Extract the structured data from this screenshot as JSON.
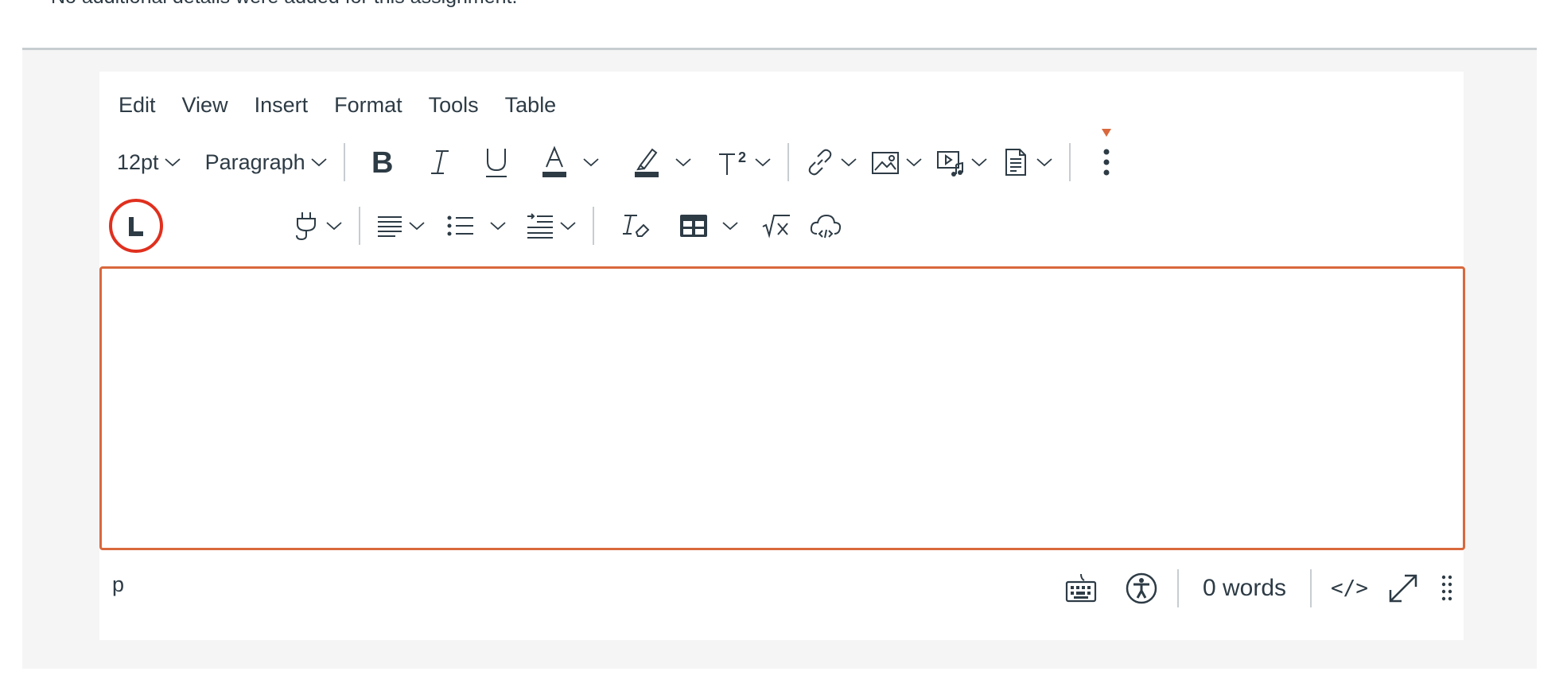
{
  "page": {
    "top_text": "No additional details were added for this assignment."
  },
  "menubar": {
    "items": [
      "Edit",
      "View",
      "Insert",
      "Format",
      "Tools",
      "Table"
    ]
  },
  "toolbar": {
    "font_size": "12pt",
    "block_format": "Paragraph",
    "icons_row1": [
      "bold-icon",
      "italic-icon",
      "underline-icon",
      "text-color-icon",
      "highlight-icon",
      "superscript-icon",
      "link-icon",
      "image-icon",
      "media-icon",
      "document-icon",
      "more-icon"
    ],
    "icons_row2": [
      "plugin-icon",
      "align-icon",
      "bullet-list-icon",
      "indent-icon",
      "clear-format-icon",
      "table-icon",
      "equation-icon",
      "cloud-embed-icon"
    ],
    "accent_color": "#d9683c",
    "highlight_ring_color": "#e0301e"
  },
  "editor": {
    "content": ""
  },
  "statusbar": {
    "path": "p",
    "word_count": "0 words",
    "html_toggle": "</>"
  }
}
